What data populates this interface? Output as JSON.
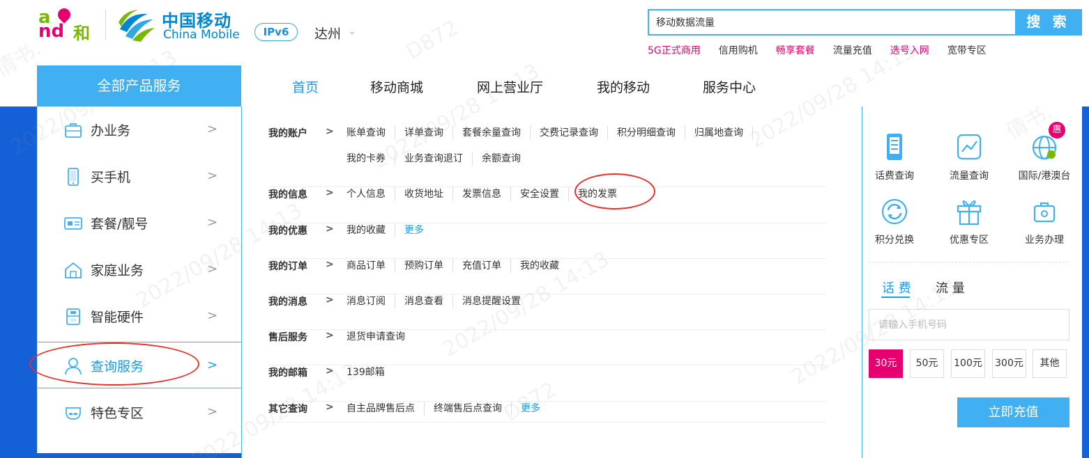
{
  "brand": {
    "and_logo_a": "a",
    "and_logo_nd": "nd",
    "and_logo_he": "和",
    "cm_name_zh": "中国移动",
    "cm_name_en": "China Mobile",
    "ipv6_badge": "IPv6",
    "city": "达州",
    "city_caret": "⌄"
  },
  "search": {
    "value": "移动数据流量",
    "button_label": "搜 索"
  },
  "hot_links": [
    {
      "label": "5G正式商用",
      "color": "#e6006f"
    },
    {
      "label": "信用购机",
      "color": "#333333"
    },
    {
      "label": "畅享套餐",
      "color": "#e6006f"
    },
    {
      "label": "流量充值",
      "color": "#333333"
    },
    {
      "label": "选号入网",
      "color": "#e6006f"
    },
    {
      "label": "宽带专区",
      "color": "#333333"
    }
  ],
  "nav": {
    "all_products": "全部产品服务",
    "items": [
      {
        "label": "首页",
        "active": true
      },
      {
        "label": "移动商城",
        "active": false
      },
      {
        "label": "网上营业厅",
        "active": false
      },
      {
        "label": "我的移动",
        "active": false
      },
      {
        "label": "服务中心",
        "active": false
      }
    ]
  },
  "left_menu": {
    "arrow": ">",
    "items": [
      {
        "label": "办业务",
        "icon": "briefcase-icon"
      },
      {
        "label": "买手机",
        "icon": "phone-icon"
      },
      {
        "label": "套餐/靓号",
        "icon": "sim-card-icon"
      },
      {
        "label": "家庭业务",
        "icon": "house-icon"
      },
      {
        "label": "智能硬件",
        "icon": "device-icon"
      },
      {
        "label": "查询服务",
        "icon": "user-icon",
        "active": true
      },
      {
        "label": "特色专区",
        "icon": "mustache-face-icon"
      }
    ]
  },
  "submenu": {
    "gt": ">",
    "sections": [
      {
        "title": "我的账户",
        "lines": [
          [
            "账单查询",
            "详单查询",
            "套餐余量查询",
            "交费记录查询",
            "积分明细查询",
            "归属地查询"
          ],
          [
            "我的卡券",
            "业务查询退订",
            "余额查询"
          ]
        ]
      },
      {
        "title": "我的信息",
        "lines": [
          [
            "个人信息",
            "收货地址",
            "发票信息",
            "安全设置",
            "我的发票"
          ]
        ]
      },
      {
        "title": "我的优惠",
        "lines": [
          [
            "我的收藏"
          ]
        ],
        "more": "更多"
      },
      {
        "title": "我的订单",
        "lines": [
          [
            "商品订单",
            "预购订单",
            "充值订单",
            "我的收藏"
          ]
        ]
      },
      {
        "title": "我的消息",
        "lines": [
          [
            "消息订阅",
            "消息查看",
            "消息提醒设置"
          ]
        ]
      },
      {
        "title": "售后服务",
        "lines": [
          [
            "退货申请查询"
          ]
        ]
      },
      {
        "title": "我的邮箱",
        "lines": [
          [
            "139邮箱"
          ]
        ]
      },
      {
        "title": "其它查询",
        "lines": [
          [
            "自主品牌售后点",
            "终端售后点查询"
          ]
        ],
        "more": "更多"
      }
    ]
  },
  "right_panel": {
    "quick_links": [
      {
        "label": "话费查询",
        "icon": "bill-query-icon"
      },
      {
        "label": "流量查询",
        "icon": "data-chart-icon"
      },
      {
        "label": "国际/港澳台",
        "icon": "globe-icon"
      },
      {
        "label": "积分兑换",
        "icon": "refresh-exchange-icon"
      },
      {
        "label": "优惠专区",
        "icon": "gift-icon"
      },
      {
        "label": "业务办理",
        "icon": "briefcase-icon"
      }
    ],
    "hui_badge": "惠",
    "tabs": [
      {
        "label": "话 费",
        "active": true
      },
      {
        "label": "流 量",
        "active": false
      }
    ],
    "phone_placeholder": "请输入手机号码",
    "amounts": [
      {
        "label": "30元",
        "selected": true
      },
      {
        "label": "50元",
        "selected": false
      },
      {
        "label": "100元",
        "selected": false
      },
      {
        "label": "300元",
        "selected": false
      },
      {
        "label": "其他",
        "selected": false
      }
    ],
    "recharge_button": "立即充值"
  },
  "colors": {
    "accent_blue": "#41b0f3",
    "band_blue": "#1460d7",
    "magenta": "#e6006f",
    "annotation_red": "#e8302a"
  },
  "watermark": {
    "name": "倩书.",
    "code": "D872",
    "timestamp": "2022/09/28 14:13"
  }
}
